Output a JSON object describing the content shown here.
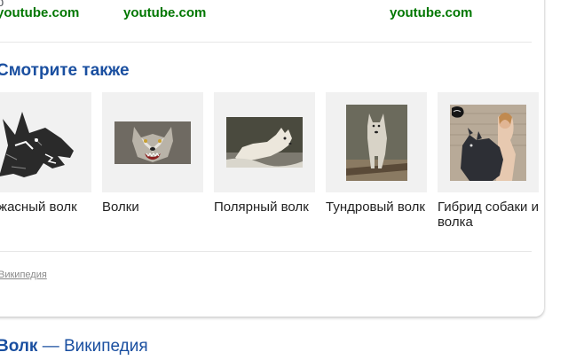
{
  "top_sources": [
    {
      "domain": "youtube.com"
    },
    {
      "domain": "youtube.com"
    },
    {
      "domain": "youtube.com"
    }
  ],
  "see_also": {
    "title": "Смотрите также",
    "items": [
      {
        "caption": "Ужасный волк",
        "image": "wolf-drawing-image"
      },
      {
        "caption": "Волки",
        "image": "wolf-snarling-photo"
      },
      {
        "caption": "Полярный волк",
        "image": "arctic-wolf-photo"
      },
      {
        "caption": "Тундровый волк",
        "image": "tundra-wolf-photo"
      },
      {
        "caption": "Гибрид собаки и волка",
        "image": "wolfdog-hybrid-photo"
      }
    ],
    "source_link": "Википедия"
  },
  "next_result": {
    "title_bold": "Волк",
    "title_rest": " — Википедия"
  },
  "colors": {
    "link": "#1a4fa0",
    "source": "#007700",
    "tile_bg": "#f1f1f1"
  }
}
